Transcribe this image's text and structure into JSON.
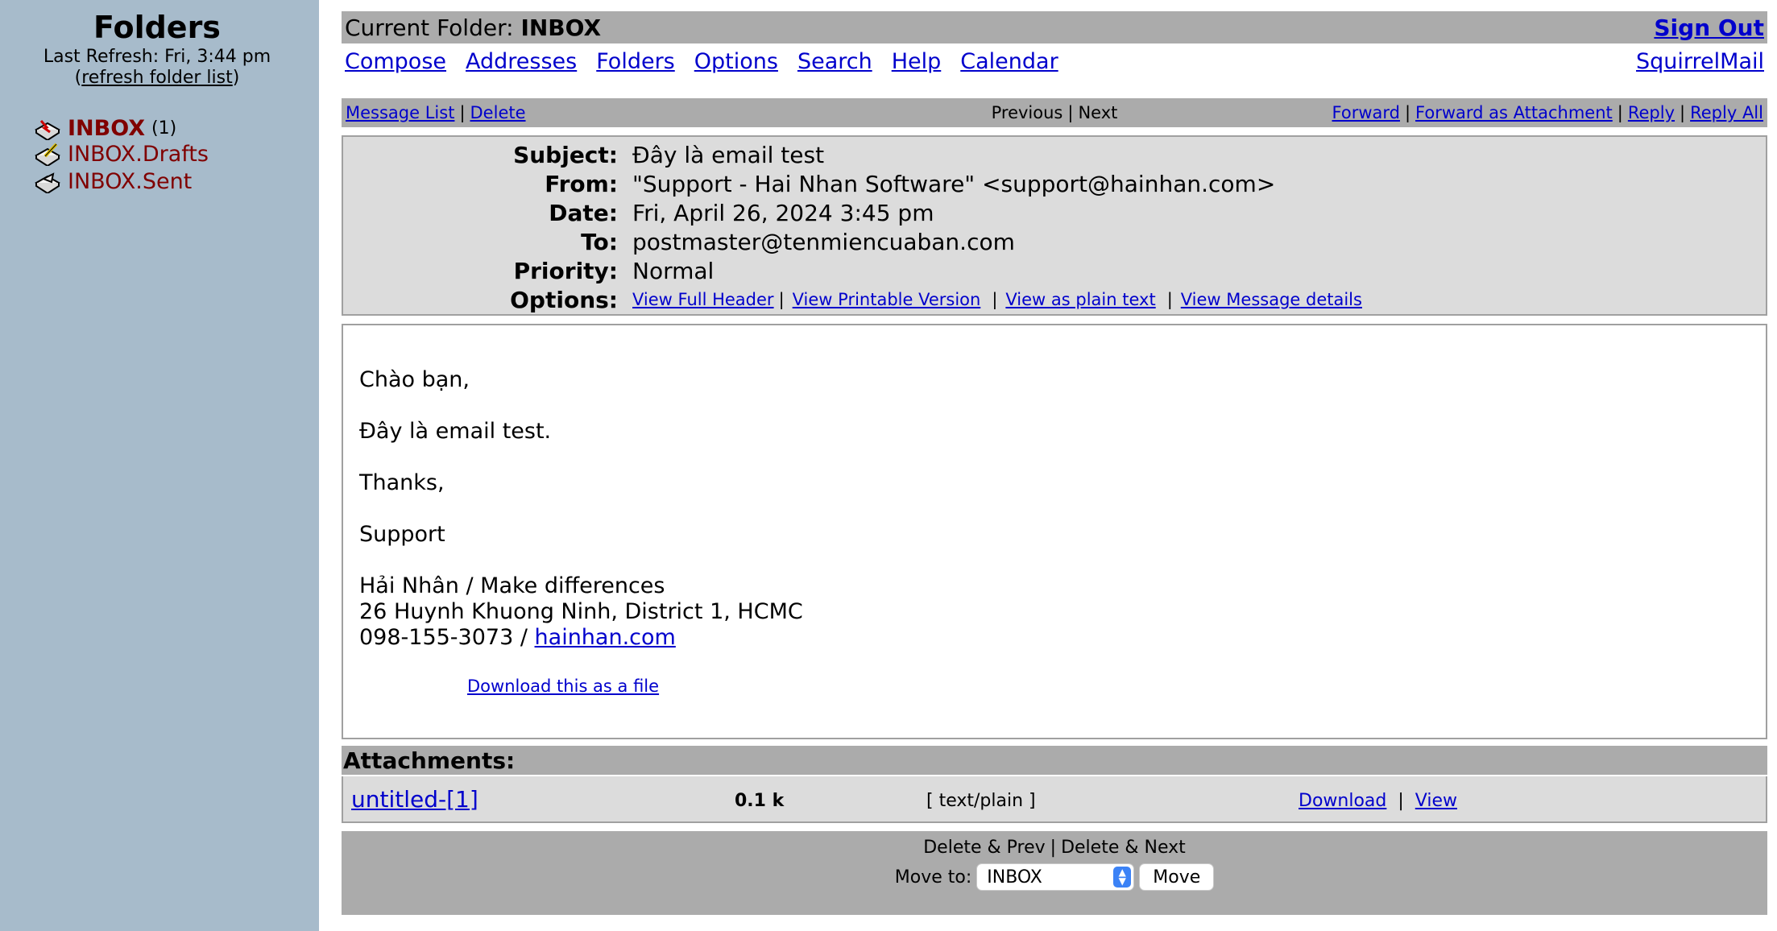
{
  "sidebar": {
    "title": "Folders",
    "last_refresh": "Last Refresh: Fri, 3:44 pm",
    "refresh_open": "(",
    "refresh_link": "refresh folder list",
    "refresh_close": ")",
    "folders": [
      {
        "name": "INBOX",
        "count": "(1)",
        "icon": "inbox-tray-icon"
      },
      {
        "name": "INBOX.Drafts",
        "icon": "drafts-pencil-icon"
      },
      {
        "name": "INBOX.Sent",
        "icon": "sent-tray-icon"
      }
    ]
  },
  "topbar": {
    "current_folder_label": "Current Folder:",
    "current_folder": "INBOX",
    "sign_out": "Sign Out"
  },
  "nav": {
    "links": [
      "Compose",
      "Addresses",
      "Folders",
      "Options",
      "Search",
      "Help",
      "Calendar"
    ],
    "brand": "SquirrelMail"
  },
  "toolbar": {
    "message_list": "Message List",
    "delete": "Delete",
    "previous": "Previous",
    "next": "Next",
    "forward": "Forward",
    "forward_attachment": "Forward as Attachment",
    "reply": "Reply",
    "reply_all": "Reply All",
    "sep": "|"
  },
  "header": {
    "subject_label": "Subject:",
    "subject": "Đây là email test",
    "from_label": "From:",
    "from": "\"Support - Hai Nhan Software\" <support@hainhan.com>",
    "date_label": "Date:",
    "date": "Fri, April 26, 2024 3:45 pm",
    "to_label": "To:",
    "to": "postmaster@tenmiencuaban.com",
    "priority_label": "Priority:",
    "priority": "Normal",
    "options_label": "Options:",
    "options": [
      "View Full Header",
      "View Printable Version",
      "View as plain text",
      "View Message details"
    ]
  },
  "body": {
    "greeting": "Chào bạn,",
    "line1": "Đây là email test.",
    "thanks": "Thanks,",
    "sender": "Support",
    "sig1": "Hải Nhân / Make differences",
    "sig2": "26 Huynh Khuong Ninh, District 1, HCMC",
    "phone": "098-155-3073 / ",
    "site": "hainhan.com",
    "download_file": "Download this as a file"
  },
  "attachments": {
    "title": "Attachments:",
    "name": "untitled-[1]",
    "size": "0.1 k",
    "type": "[ text/plain ]",
    "download": "Download",
    "view": "View"
  },
  "bottom": {
    "delete_prev": "Delete & Prev",
    "delete_next": "Delete & Next",
    "move_to_label": "Move to:",
    "move_selected": "INBOX",
    "move_button": "Move"
  },
  "colors": {
    "sidebar_bg": "#a7bbcb",
    "bar_gray": "#ababab",
    "panel_gray": "#dcdcdc",
    "link": "#0000cc",
    "folder_text": "#800000"
  }
}
